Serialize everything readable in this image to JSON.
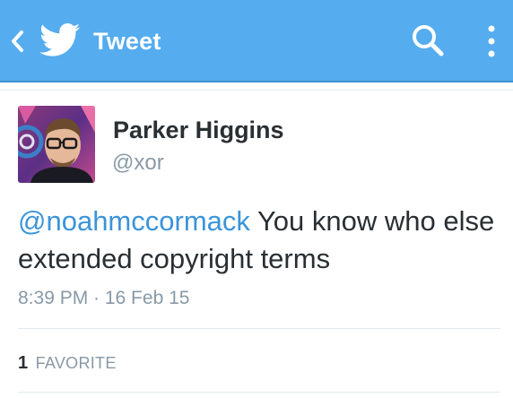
{
  "colors": {
    "bar_background": "#55acee",
    "mention_blue": "#3b94d9",
    "name_text": "#292f33",
    "meta_gray": "#8899a6"
  },
  "header": {
    "back_icon": "chevron-left-icon",
    "logo_icon": "twitter-bird-icon",
    "title": "Tweet",
    "search_icon": "search-icon",
    "overflow_icon": "overflow-menu-icon"
  },
  "tweet": {
    "avatar_icon": "avatar-photo",
    "author_name": "Parker Higgins",
    "author_handle": "@xor",
    "mention": "@noahmccormack",
    "text": " You know who else extended copyright terms",
    "timestamp": "8:39 PM · 16 Feb 15"
  },
  "stats": {
    "favorite_count": "1",
    "favorite_label": "FAVORITE"
  }
}
